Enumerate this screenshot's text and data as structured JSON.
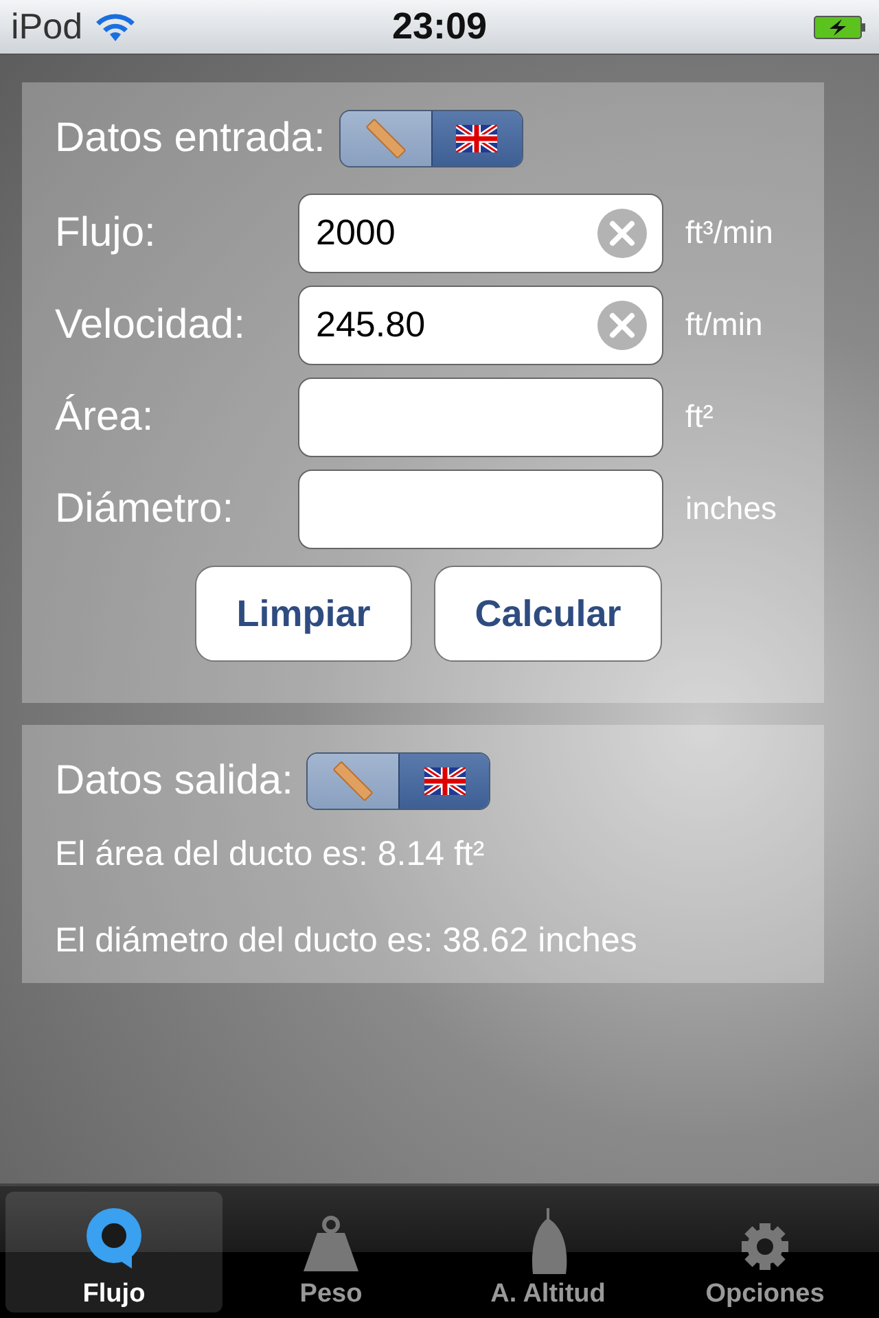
{
  "status_bar": {
    "carrier": "iPod",
    "time": "23:09"
  },
  "input": {
    "title": "Datos entrada:",
    "units": [
      {
        "kind": "metric",
        "selected": false
      },
      {
        "kind": "imperial",
        "selected": true
      }
    ],
    "fields": [
      {
        "label": "Flujo:",
        "value": "2000",
        "unit": "ft³/min"
      },
      {
        "label": "Velocidad:",
        "value": "245.80",
        "unit": "ft/min"
      },
      {
        "label": "Área:",
        "unit": "ft²"
      },
      {
        "label": "Diámetro:",
        "unit": "inches"
      }
    ],
    "buttons": [
      "Limpiar",
      "Calcular"
    ]
  },
  "output": {
    "title": "Datos salida:",
    "units": [
      {
        "kind": "metric",
        "selected": false
      },
      {
        "kind": "imperial",
        "selected": true
      }
    ],
    "results": [
      "El área del ducto es: 8.14 ft²",
      "El diámetro del ducto es: 38.62 inches"
    ]
  },
  "tabs": [
    {
      "label": "Flujo",
      "kind": "flow",
      "selected": true
    },
    {
      "label": "Peso",
      "kind": "weight",
      "selected": false
    },
    {
      "label": "A. Altitud",
      "kind": "altitude",
      "selected": false
    },
    {
      "label": "Opciones",
      "kind": "settings",
      "selected": false
    }
  ]
}
